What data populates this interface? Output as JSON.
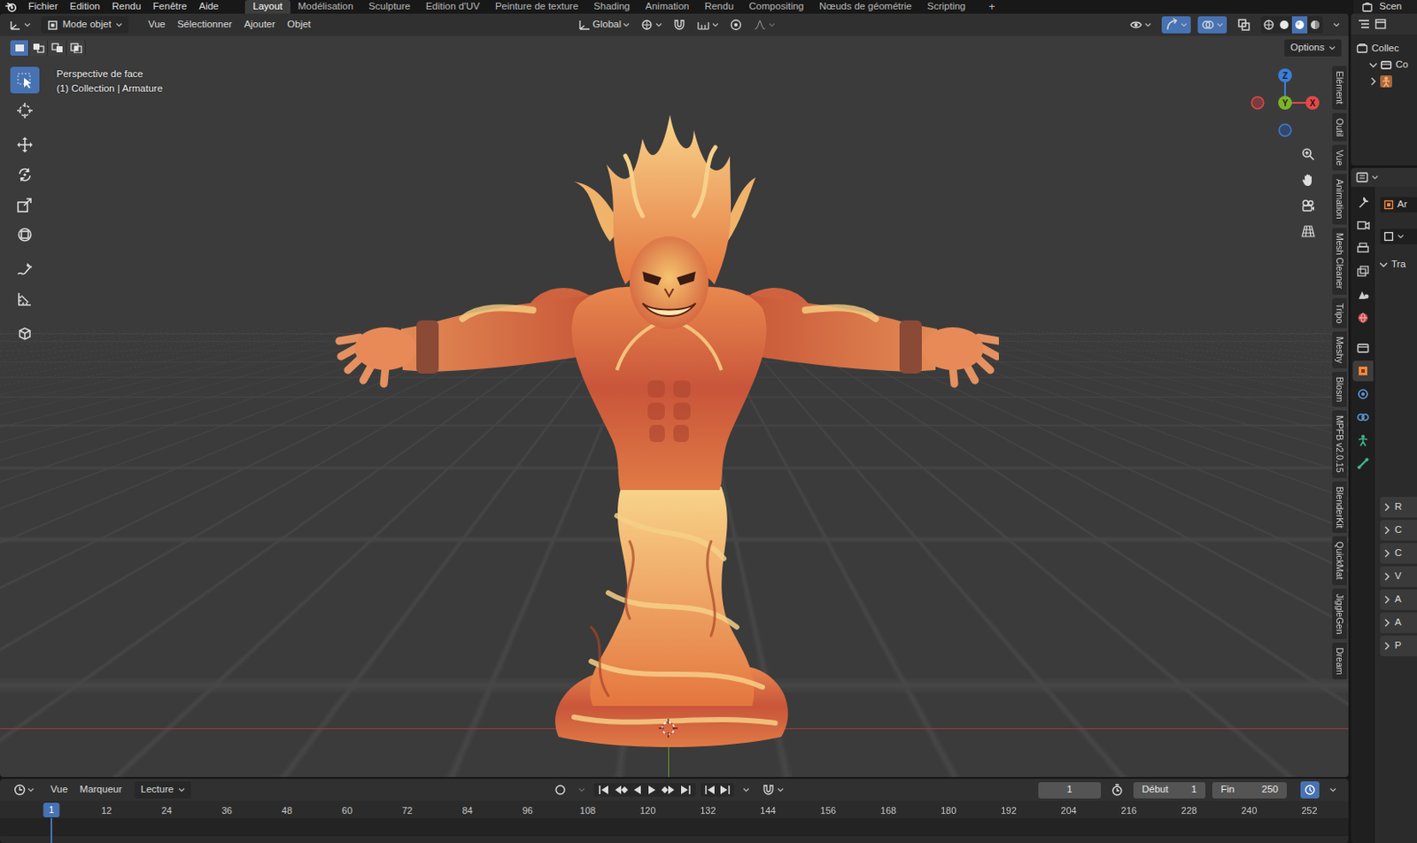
{
  "topbar": {
    "menus": [
      "Fichier",
      "Edition",
      "Rendu",
      "Fenêtre",
      "Aide"
    ],
    "workspaces": [
      {
        "label": "Layout",
        "selected": true
      },
      {
        "label": "Modélisation",
        "selected": false
      },
      {
        "label": "Sculpture",
        "selected": false
      },
      {
        "label": "Edition d'UV",
        "selected": false
      },
      {
        "label": "Peinture de texture",
        "selected": false
      },
      {
        "label": "Shading",
        "selected": false
      },
      {
        "label": "Animation",
        "selected": false
      },
      {
        "label": "Rendu",
        "selected": false
      },
      {
        "label": "Compositing",
        "selected": false
      },
      {
        "label": "Nœuds de géométrie",
        "selected": false
      },
      {
        "label": "Scripting",
        "selected": false
      }
    ],
    "add_workspace": "+",
    "scene": "Scen"
  },
  "viewport": {
    "mode": "Mode objet",
    "menus": [
      "Vue",
      "Sélectionner",
      "Ajouter",
      "Objet"
    ],
    "orientation": "Global",
    "snap": {
      "on": false
    },
    "proportional": {
      "on": false
    },
    "toggles": [
      {
        "on": false
      },
      {
        "on": true
      },
      {
        "on": true
      },
      {
        "on": false
      }
    ],
    "shading": [
      {
        "selected": false
      },
      {
        "selected": false
      },
      {
        "selected": true
      },
      {
        "selected": false
      }
    ],
    "select_modes": [
      {
        "selected": true
      },
      {
        "selected": false
      },
      {
        "selected": false
      },
      {
        "selected": false
      }
    ],
    "options": "Options",
    "view_name": "Perspective de face",
    "context": "(1) Collection | Armature",
    "tools": [
      {
        "selected": true
      },
      {
        "selected": false
      },
      {
        "selected": false
      },
      {
        "selected": false
      },
      {
        "selected": false
      },
      {
        "selected": false
      },
      {
        "selected": false
      },
      {
        "selected": false
      },
      {
        "selected": false
      }
    ],
    "gizmo": {
      "x": "X",
      "y": "Y",
      "z": "Z"
    },
    "sidebar_tabs": [
      "Elément",
      "Outil",
      "Vue",
      "Animation",
      "Mesh Cleaner",
      "Tripo",
      "Meshy",
      "Blosm",
      "MPFB v2.0.15",
      "BlenderKit",
      "QuickMat",
      "JiggleGen",
      "Dream"
    ]
  },
  "timeline": {
    "menus": [
      "Vue",
      "Marqueur"
    ],
    "playback": "Lecture",
    "auto_key": {
      "on": false
    },
    "current_frame": "1",
    "preview_range": {
      "on": false
    },
    "start_label": "Début",
    "start": "1",
    "end_label": "Fin",
    "end": "250",
    "sync": {
      "on": true
    },
    "playhead": "1",
    "ruler": [
      "12",
      "24",
      "36",
      "48",
      "60",
      "72",
      "84",
      "96",
      "108",
      "120",
      "132",
      "144",
      "156",
      "168",
      "180",
      "192",
      "204",
      "216",
      "228",
      "240",
      "252"
    ]
  },
  "outliner": {
    "rows": [
      {
        "label": "Collec",
        "kind": "scene"
      },
      {
        "label": "Co",
        "kind": "collection",
        "expanded": true
      },
      {
        "kind": "armature",
        "expanded": false
      }
    ]
  },
  "properties": {
    "tabs": [
      {
        "selected": false
      },
      {
        "selected": false
      },
      {
        "selected": false
      },
      {
        "selected": false
      },
      {
        "selected": false
      },
      {
        "selected": false
      },
      {
        "selected": false
      },
      {
        "selected": true
      },
      {
        "selected": false
      },
      {
        "selected": false
      },
      {
        "selected": false
      },
      {
        "selected": false
      }
    ],
    "object_name": "Ar",
    "panel": "Tra",
    "panel_expanded": true,
    "rows": [
      {
        "label": "R",
        "expanded": false
      },
      {
        "label": "C",
        "expanded": false
      },
      {
        "label": "C",
        "expanded": false
      },
      {
        "label": "V",
        "expanded": false
      },
      {
        "label": "A",
        "expanded": false
      },
      {
        "label": "A",
        "expanded": false
      },
      {
        "label": "P",
        "expanded": false
      }
    ]
  }
}
